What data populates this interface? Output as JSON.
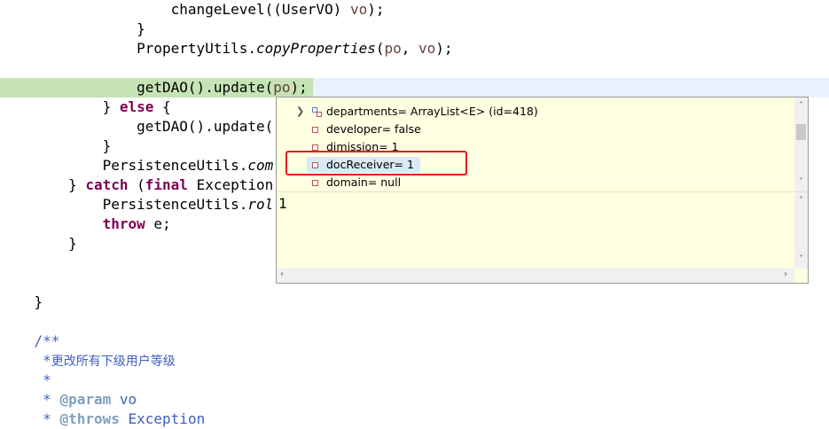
{
  "editor": {
    "line1": {
      "call": "changeLevel((UserVO) ",
      "var": "vo",
      "end": ");"
    },
    "line2": "}",
    "line3": {
      "cls": "PropertyUtils.",
      "method": "copyProperties",
      "open": "(",
      "a": "po",
      "sep": ", ",
      "b": "vo",
      "end": ");"
    },
    "line5": {
      "call": "getDAO().update(",
      "var": "po",
      "end": ");"
    },
    "line6": {
      "brace": "} ",
      "kw": "else",
      "end": " {"
    },
    "line7": "getDAO().update(",
    "line8": "}",
    "line9": {
      "cls": "PersistenceUtils.",
      "method": "com"
    },
    "line10": {
      "brace": "} ",
      "kw1": "catch",
      "open": " (",
      "kw2": "final",
      "rest": " Exception"
    },
    "line11": {
      "cls": "PersistenceUtils.",
      "method": "rol"
    },
    "line12": {
      "kw": "throw",
      "rest": " e;"
    },
    "line13": "}",
    "line15": "}",
    "doc1": "/**",
    "doc2_star": " *",
    "doc2_text": "更改所有下级用户等级",
    "doc3": " *",
    "doc4": {
      "star": " * ",
      "tag": "@param",
      "rest": " vo"
    },
    "doc5": {
      "star": " * ",
      "tag": "@throws",
      "rest": " Exception"
    }
  },
  "popup": {
    "items": [
      {
        "label": "departments= ArrayList<E>  (id=418)",
        "icon": "collection-field-icon",
        "expandable": true
      },
      {
        "label": "developer= false",
        "icon": "field-icon"
      },
      {
        "label": "dimission= 1",
        "icon": "field-icon"
      },
      {
        "label": "docReceiver= 1",
        "icon": "field-icon",
        "selected": true
      },
      {
        "label": "domain= null",
        "icon": "field-icon"
      }
    ],
    "detail_value": "1",
    "highlight_color": "#e0201c"
  }
}
